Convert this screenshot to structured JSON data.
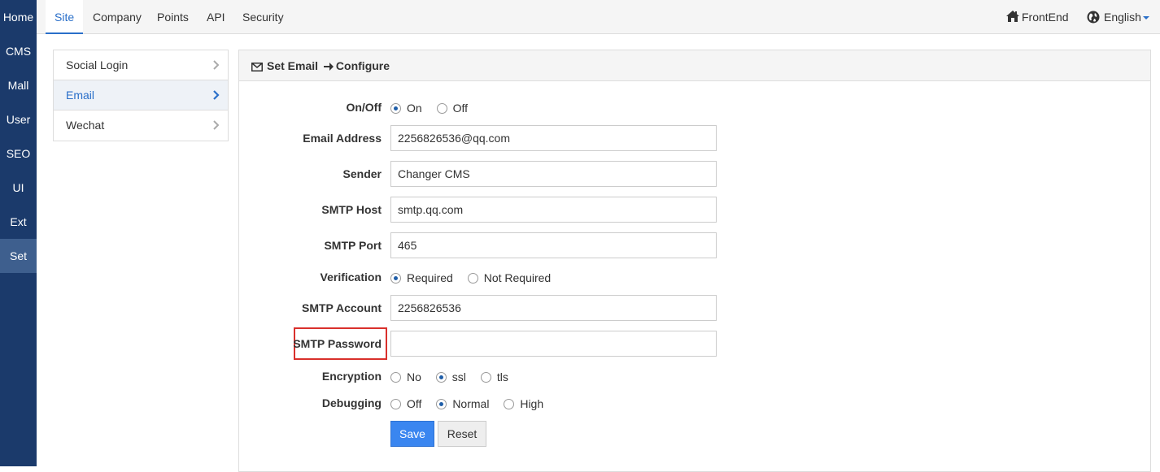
{
  "leftnav": {
    "items": [
      {
        "label": "Home"
      },
      {
        "label": "CMS"
      },
      {
        "label": "Mall"
      },
      {
        "label": "User"
      },
      {
        "label": "SEO"
      },
      {
        "label": "UI"
      },
      {
        "label": "Ext"
      },
      {
        "label": "Set"
      }
    ],
    "active": "Set"
  },
  "topbar": {
    "tabs": [
      {
        "label": "Site"
      },
      {
        "label": "Company"
      },
      {
        "label": "Points"
      },
      {
        "label": "API"
      },
      {
        "label": "Security"
      }
    ],
    "active_tab": "Site",
    "frontend_label": "FrontEnd",
    "language_label": "English"
  },
  "submenu": {
    "items": [
      {
        "label": "Social Login"
      },
      {
        "label": "Email"
      },
      {
        "label": "Wechat"
      }
    ],
    "active": "Email"
  },
  "panel": {
    "title_part1": "Set Email",
    "title_part2": "Configure"
  },
  "form": {
    "onoff": {
      "label": "On/Off",
      "options": [
        "On",
        "Off"
      ],
      "selected": "On"
    },
    "email_address": {
      "label": "Email Address",
      "value": "2256826536@qq.com"
    },
    "sender": {
      "label": "Sender",
      "value": "Changer CMS"
    },
    "smtp_host": {
      "label": "SMTP Host",
      "value": "smtp.qq.com"
    },
    "smtp_port": {
      "label": "SMTP Port",
      "value": "465"
    },
    "verification": {
      "label": "Verification",
      "options": [
        "Required",
        "Not Required"
      ],
      "selected": "Required"
    },
    "smtp_account": {
      "label": "SMTP Account",
      "value": "2256826536"
    },
    "smtp_password": {
      "label": "SMTP Password",
      "value": ""
    },
    "encryption": {
      "label": "Encryption",
      "options": [
        "No",
        "ssl",
        "tls"
      ],
      "selected": "ssl"
    },
    "debugging": {
      "label": "Debugging",
      "options": [
        "Off",
        "Normal",
        "High"
      ],
      "selected": "Normal"
    },
    "save_label": "Save",
    "reset_label": "Reset"
  },
  "colors": {
    "sidebar": "#1b3a6b",
    "accent": "#2a6fc9",
    "highlight_border": "#d9302c",
    "save_button": "#3a86f0"
  }
}
